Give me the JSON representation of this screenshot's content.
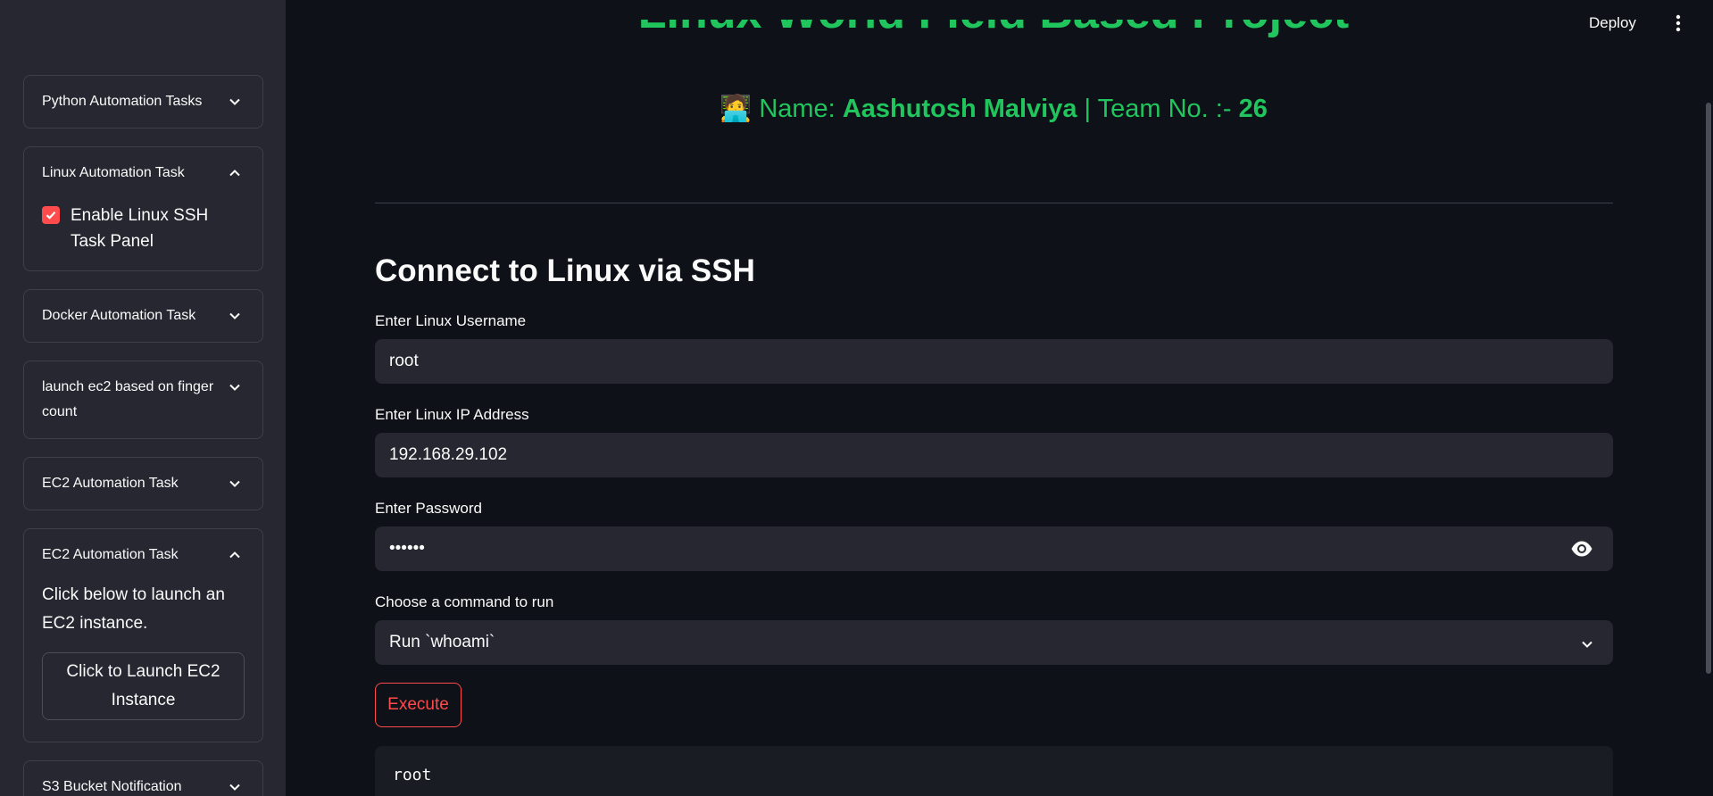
{
  "header": {
    "deploy_label": "Deploy",
    "clipped_title": "Linux World Field Based Project",
    "name_prefix": "Name: ",
    "name_value": "Aashutosh Malviya",
    "team_prefix": " | Team No. :- ",
    "team_value": "26",
    "name_emoji": "🧑‍💻"
  },
  "sidebar": {
    "expanders": [
      {
        "label": "Python Automation Tasks",
        "expanded": false
      },
      {
        "label": "Linux Automation Task",
        "expanded": true,
        "checkbox_label": "Enable Linux SSH Task Panel",
        "checked": true
      },
      {
        "label": "Docker Automation Task",
        "expanded": false
      },
      {
        "label": "launch ec2 based on finger count",
        "expanded": false
      },
      {
        "label": "EC2 Automation Task",
        "expanded": false
      },
      {
        "label": "EC2 Automation Task",
        "expanded": true,
        "text": "Click below to launch an EC2 instance.",
        "button_label": "Click to Launch EC2 Instance"
      },
      {
        "label": "S3 Bucket Notification",
        "expanded": false
      }
    ]
  },
  "main": {
    "section_title": "Connect to Linux via SSH",
    "username": {
      "label": "Enter Linux Username",
      "value": "root"
    },
    "ip": {
      "label": "Enter Linux IP Address",
      "value": "192.168.29.102"
    },
    "password": {
      "label": "Enter Password",
      "value": "••••••"
    },
    "command": {
      "label": "Choose a command to run",
      "value": "Run `whoami`"
    },
    "execute_label": "Execute",
    "output": "root"
  },
  "colors": {
    "accent_green": "#21c55d",
    "accent_red": "#ff4b4b",
    "background": "#0e1117",
    "sidebar_bg": "#262730"
  }
}
